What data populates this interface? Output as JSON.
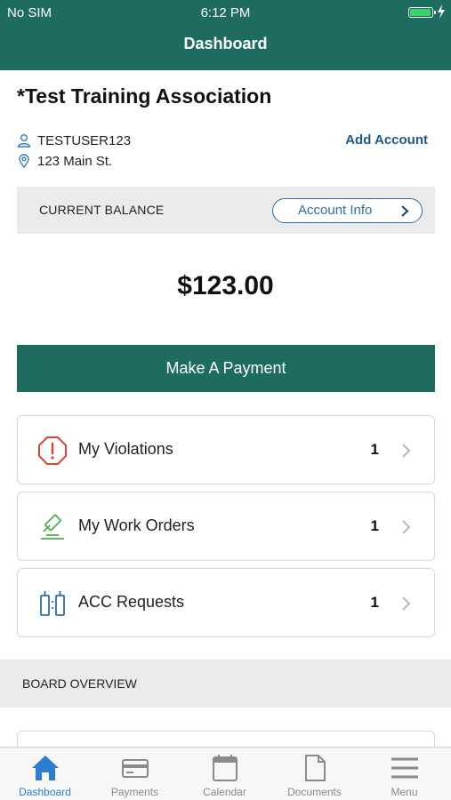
{
  "status_bar": {
    "carrier": "No SIM",
    "time": "6:12 PM",
    "battery_level": 1.0
  },
  "nav": {
    "title": "Dashboard"
  },
  "association": {
    "name": "*Test Training Association"
  },
  "account": {
    "username": "TESTUSER123",
    "address": "123 Main St.",
    "add_account_label": "Add Account"
  },
  "balance": {
    "label": "CURRENT BALANCE",
    "account_info_label": "Account Info",
    "amount": "$123.00"
  },
  "actions": {
    "make_payment_label": "Make A Payment"
  },
  "cards": [
    {
      "label": "My Violations",
      "count": "1",
      "icon": "violation-octagon-icon"
    },
    {
      "label": "My Work Orders",
      "count": "1",
      "icon": "work-order-icon"
    },
    {
      "label": "ACC Requests",
      "count": "1",
      "icon": "acc-request-icon"
    }
  ],
  "board": {
    "label": "BOARD OVERVIEW"
  },
  "tabs": [
    {
      "label": "Dashboard",
      "icon": "home-icon",
      "active": true
    },
    {
      "label": "Payments",
      "icon": "credit-card-icon",
      "active": false
    },
    {
      "label": "Calendar",
      "icon": "calendar-icon",
      "active": false
    },
    {
      "label": "Documents",
      "icon": "document-icon",
      "active": false
    },
    {
      "label": "Menu",
      "icon": "hamburger-menu-icon",
      "active": false
    }
  ],
  "colors": {
    "brand": "#1e6b5f",
    "link": "#1a5a8a",
    "tab_active": "#2e7dd1",
    "violation": "#e0452a",
    "work_order": "#4caf50",
    "acc": "#2e6fa8"
  }
}
